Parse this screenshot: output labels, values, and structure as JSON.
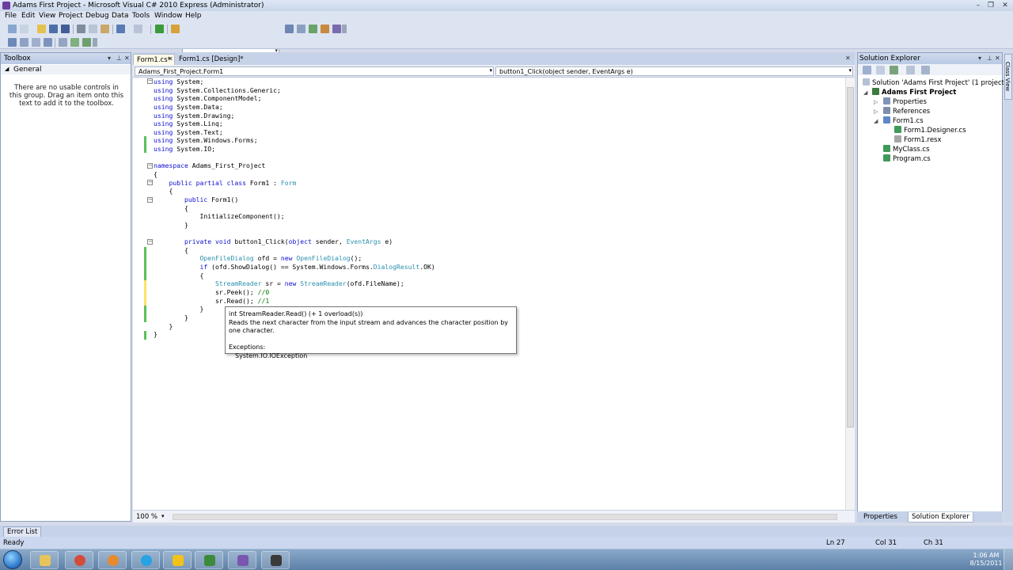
{
  "window": {
    "title": "Adams First Project - Microsoft Visual C# 2010 Express (Administrator)",
    "controls": [
      "–",
      "❐",
      "✕"
    ]
  },
  "menu": [
    "File",
    "Edit",
    "View",
    "Project",
    "Debug",
    "Data",
    "Tools",
    "Window",
    "Help"
  ],
  "toolbox": {
    "title": "Toolbox",
    "group": "General",
    "empty_message": "There are no usable controls in this group. Drag an item onto this text to add it to the toolbox."
  },
  "editor": {
    "tabs": [
      "Form1.cs*",
      "Form1.cs [Design]*"
    ],
    "nav_type": "Adams_First_Project.Form1",
    "nav_member": "button1_Click(object sender, EventArgs e)",
    "zoom": "100 %",
    "code": [
      "using System;",
      "using System.Collections.Generic;",
      "using System.ComponentModel;",
      "using System.Data;",
      "using System.Drawing;",
      "using System.Linq;",
      "using System.Text;",
      "using System.Windows.Forms;",
      "using System.IO;",
      "",
      "namespace Adams_First_Project",
      "{",
      "    public partial class Form1 : Form",
      "    {",
      "        public Form1()",
      "        {",
      "            InitializeComponent();",
      "        }",
      "",
      "        private void button1_Click(object sender, EventArgs e)",
      "        {",
      "            OpenFileDialog ofd = new OpenFileDialog();",
      "            if (ofd.ShowDialog() == System.Windows.Forms.DialogResult.OK)",
      "            {",
      "                StreamReader sr = new StreamReader(ofd.FileName);",
      "                sr.Peek(); //0",
      "                sr.Read(); //1",
      "            }",
      "        }",
      "    }",
      "}"
    ]
  },
  "tooltip": {
    "signature": "int StreamReader.Read()  (+ 1 overload(s))",
    "description": "Reads the next character from the input stream and advances the character position by one character.",
    "exceptions_label": "Exceptions:",
    "exception": "System.IO.IOException"
  },
  "solution_explorer": {
    "title": "Solution Explorer",
    "items": [
      "Solution 'Adams First Project' (1 project)",
      "Adams First Project",
      "Properties",
      "References",
      "Form1.cs",
      "Form1.Designer.cs",
      "Form1.resx",
      "MyClass.cs",
      "Program.cs"
    ],
    "bottom_tabs": [
      "Properties",
      "Solution Explorer"
    ]
  },
  "side_tab": "Class View",
  "error_list": "Error List",
  "status": {
    "ready": "Ready",
    "ln": "Ln 27",
    "col": "Col 31",
    "ch": "Ch 31"
  },
  "taskbar": {
    "time": "1:06 AM",
    "date": "8/15/2011"
  }
}
